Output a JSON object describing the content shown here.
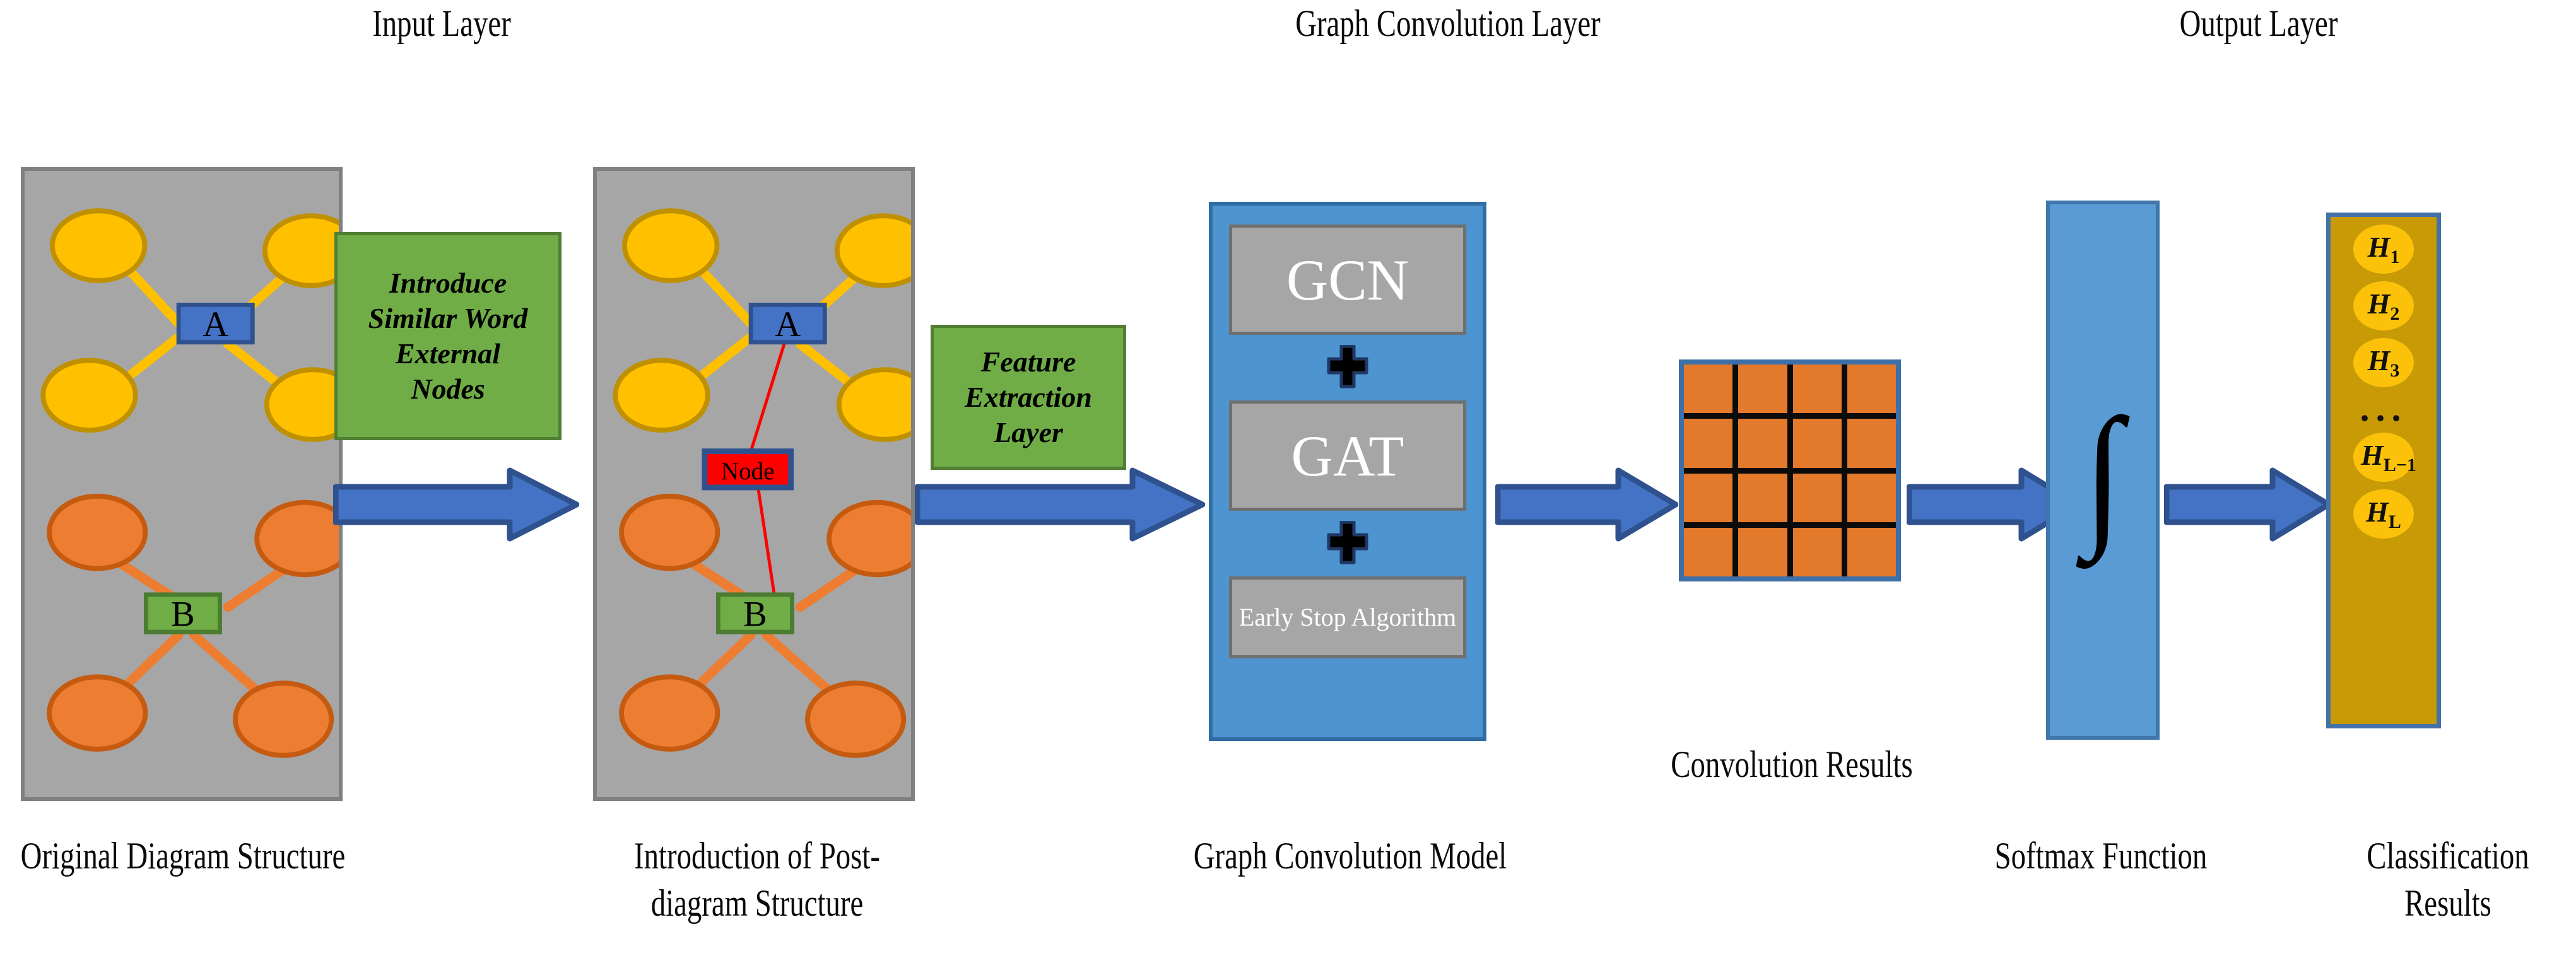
{
  "headers": [
    {
      "text": "Input Layer"
    },
    {
      "text": "Graph Convolution Layer"
    },
    {
      "text": "Output Layer"
    }
  ],
  "captions": [
    {
      "text": "Original Diagram Structure"
    },
    {
      "text": "Introduction of Post-diagram Structure"
    },
    {
      "text": "Graph Convolution Model"
    },
    {
      "text": "Convolution Results"
    },
    {
      "text": "Softmax Function"
    },
    {
      "text": "Classification Results"
    }
  ],
  "panel1": {
    "name": "Original Diagram Structure",
    "node_a_label": "A",
    "node_b_label": "B",
    "background": "#a6a6a6",
    "node_a_color": "#4472c4",
    "node_b_color": "#70ad47",
    "yellow_node_color": "#ffc000",
    "orange_node_color": "#ed7d31"
  },
  "panel2": {
    "name": "Introduction of Post-diagram Structure",
    "node_a_label": "A",
    "node_b_label": "B",
    "external_node_label": "Node",
    "external_node_color": "#ff0000",
    "external_edge_color": "#ff0000"
  },
  "process_boxes": [
    {
      "lines": [
        "Introduce",
        "Similar Word",
        "External",
        "Nodes"
      ],
      "color": "#70ad47"
    },
    {
      "lines": [
        "Feature",
        "Extraction",
        "Layer"
      ],
      "color": "#70ad47"
    }
  ],
  "model": {
    "background": "#4e94d1",
    "items": [
      {
        "label": "GCN",
        "kind": "big"
      },
      {
        "label": "plus-icon",
        "kind": "plus"
      },
      {
        "label": "GAT",
        "kind": "big"
      },
      {
        "label": "plus-icon",
        "kind": "plus"
      },
      {
        "label": "Early Stop Algorithm",
        "kind": "small"
      }
    ]
  },
  "conv_grid": {
    "rows": 4,
    "cols": 4,
    "cell_color": "#e3792b",
    "line_color": "#000000",
    "border_color": "#3d6fa8"
  },
  "softmax": {
    "symbol": "∫",
    "background": "#5b9bd5"
  },
  "output": {
    "background": "#c79a06",
    "border": "#4472a8",
    "node_color": "#fcc20a",
    "nodes": [
      {
        "base": "H",
        "sub": "1"
      },
      {
        "base": "H",
        "sub": "2"
      },
      {
        "base": "H",
        "sub": "3"
      },
      {
        "base": "...",
        "sub": ""
      },
      {
        "base": "H",
        "sub": "L−1"
      },
      {
        "base": "H",
        "sub": "L"
      }
    ]
  },
  "arrows": {
    "color": "#4472c4",
    "border": "#2f528f",
    "count": 5
  }
}
